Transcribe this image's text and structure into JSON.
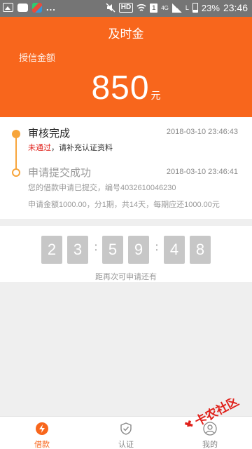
{
  "status_bar": {
    "dots": "...",
    "hd": "HD",
    "sim": "1",
    "net": "4G",
    "carrier": "L",
    "battery": "23%",
    "time": "23:46"
  },
  "header": {
    "title": "及时金",
    "amount_label": "授信金额",
    "amount": "850",
    "unit": "元"
  },
  "timeline": {
    "step1": {
      "title": "审核完成",
      "date": "2018-03-10 23:46:43",
      "desc_red": "未通过",
      "desc_rest": "，请补充认证资料"
    },
    "step2": {
      "title": "申请提交成功",
      "date": "2018-03-10 23:46:41",
      "desc1": "您的借款申请已提交，编号4032610046230",
      "desc2": "申请金额1000.00，分1期，共14天，每期应还1000.00元"
    }
  },
  "countdown": {
    "digits": [
      "2",
      "3",
      "5",
      "9",
      "4",
      "8"
    ],
    "colon": ":",
    "hint": "距再次可申请还有"
  },
  "tabbar": {
    "tabs": [
      {
        "label": "借款",
        "icon": "lightning-icon",
        "active": true
      },
      {
        "label": "认证",
        "icon": "shield-check-icon",
        "active": false
      },
      {
        "label": "我的",
        "icon": "user-icon",
        "active": false
      }
    ]
  },
  "watermark": {
    "text": "卡农社区"
  },
  "colors": {
    "brand_orange": "#f8661c",
    "timeline_orange": "#f7a53b",
    "error_red": "#e0211b",
    "countdown_box": "#c7c7c7"
  }
}
